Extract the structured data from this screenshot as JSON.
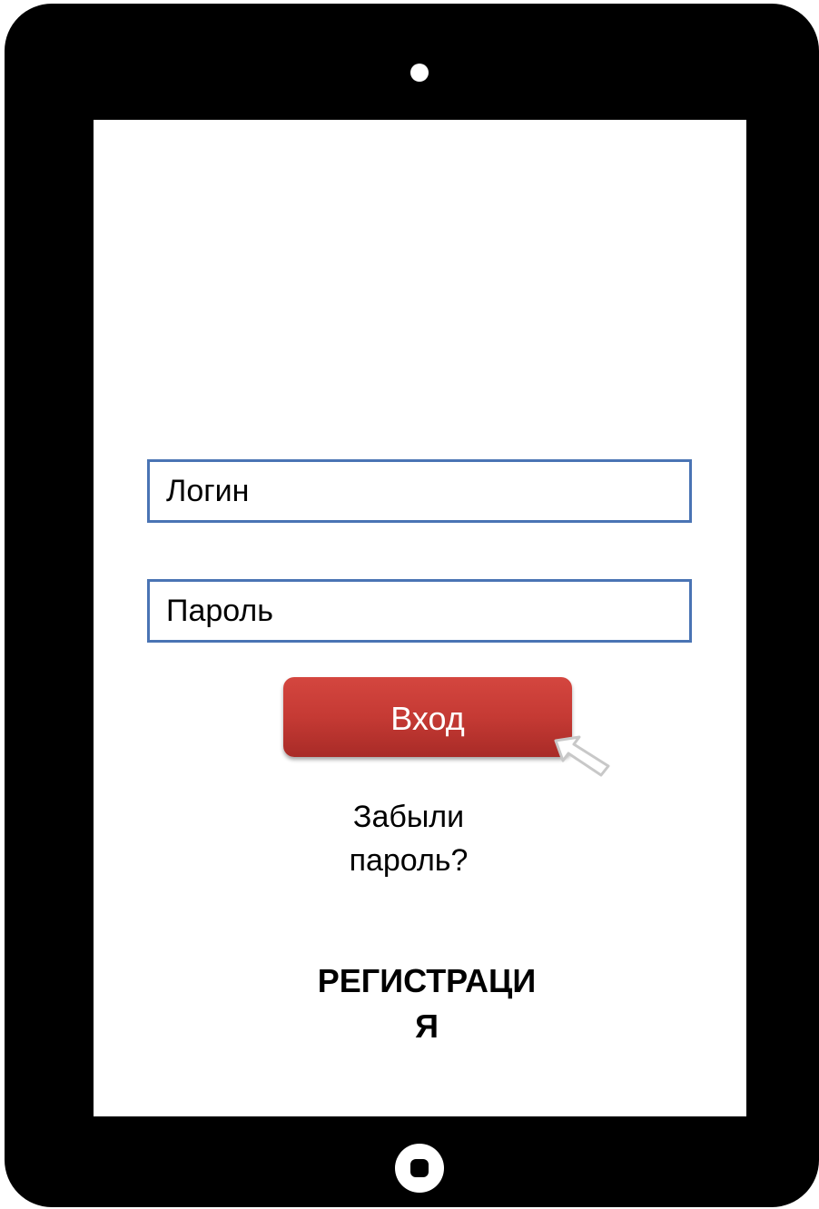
{
  "login": {
    "login_placeholder": "Логин",
    "password_placeholder": "Пароль",
    "enter_label": "Вход",
    "forgot_line1": "Забыли",
    "forgot_line2": "пароль?",
    "register_line1": "РЕГИСТРАЦИ",
    "register_line2": "Я"
  },
  "colors": {
    "bezel": "#000000",
    "screen": "#ffffff",
    "field_border": "#4a74b4",
    "button": "#c53a34",
    "button_text": "#ffffff"
  },
  "icons": {
    "camera": "camera-icon",
    "home": "home-button-icon",
    "pointer": "cursor-arrow-icon"
  }
}
